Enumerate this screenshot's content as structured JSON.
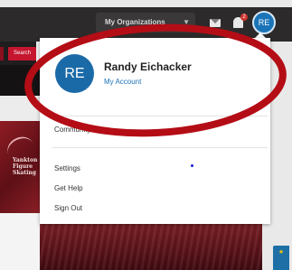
{
  "topbar": {
    "org_dropdown_label": "My Organizations",
    "notification_count": "2",
    "user_initials": "RE"
  },
  "sidebar": {
    "search_label": "Search",
    "promo_text": [
      "Yankton",
      "Figure",
      "Skating"
    ]
  },
  "account_menu": {
    "initials": "RE",
    "user_name": "Randy Eichacker",
    "my_account_label": "My Account",
    "items": [
      {
        "label": "Community Site"
      },
      {
        "label": "Settings"
      },
      {
        "label": "Get Help"
      },
      {
        "label": "Sign Out"
      }
    ]
  },
  "annotation": {
    "highlight_color": "#b40d16"
  }
}
